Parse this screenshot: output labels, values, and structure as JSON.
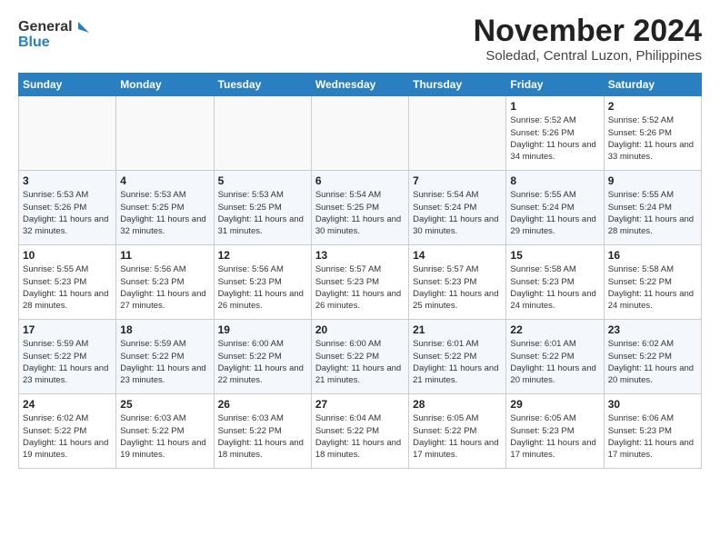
{
  "logo": {
    "text_general": "General",
    "text_blue": "Blue"
  },
  "header": {
    "month": "November 2024",
    "location": "Soledad, Central Luzon, Philippines"
  },
  "weekdays": [
    "Sunday",
    "Monday",
    "Tuesday",
    "Wednesday",
    "Thursday",
    "Friday",
    "Saturday"
  ],
  "weeks": [
    [
      {
        "day": "",
        "info": ""
      },
      {
        "day": "",
        "info": ""
      },
      {
        "day": "",
        "info": ""
      },
      {
        "day": "",
        "info": ""
      },
      {
        "day": "",
        "info": ""
      },
      {
        "day": "1",
        "info": "Sunrise: 5:52 AM\nSunset: 5:26 PM\nDaylight: 11 hours\nand 34 minutes."
      },
      {
        "day": "2",
        "info": "Sunrise: 5:52 AM\nSunset: 5:26 PM\nDaylight: 11 hours\nand 33 minutes."
      }
    ],
    [
      {
        "day": "3",
        "info": "Sunrise: 5:53 AM\nSunset: 5:26 PM\nDaylight: 11 hours\nand 32 minutes."
      },
      {
        "day": "4",
        "info": "Sunrise: 5:53 AM\nSunset: 5:25 PM\nDaylight: 11 hours\nand 32 minutes."
      },
      {
        "day": "5",
        "info": "Sunrise: 5:53 AM\nSunset: 5:25 PM\nDaylight: 11 hours\nand 31 minutes."
      },
      {
        "day": "6",
        "info": "Sunrise: 5:54 AM\nSunset: 5:25 PM\nDaylight: 11 hours\nand 30 minutes."
      },
      {
        "day": "7",
        "info": "Sunrise: 5:54 AM\nSunset: 5:24 PM\nDaylight: 11 hours\nand 30 minutes."
      },
      {
        "day": "8",
        "info": "Sunrise: 5:55 AM\nSunset: 5:24 PM\nDaylight: 11 hours\nand 29 minutes."
      },
      {
        "day": "9",
        "info": "Sunrise: 5:55 AM\nSunset: 5:24 PM\nDaylight: 11 hours\nand 28 minutes."
      }
    ],
    [
      {
        "day": "10",
        "info": "Sunrise: 5:55 AM\nSunset: 5:23 PM\nDaylight: 11 hours\nand 28 minutes."
      },
      {
        "day": "11",
        "info": "Sunrise: 5:56 AM\nSunset: 5:23 PM\nDaylight: 11 hours\nand 27 minutes."
      },
      {
        "day": "12",
        "info": "Sunrise: 5:56 AM\nSunset: 5:23 PM\nDaylight: 11 hours\nand 26 minutes."
      },
      {
        "day": "13",
        "info": "Sunrise: 5:57 AM\nSunset: 5:23 PM\nDaylight: 11 hours\nand 26 minutes."
      },
      {
        "day": "14",
        "info": "Sunrise: 5:57 AM\nSunset: 5:23 PM\nDaylight: 11 hours\nand 25 minutes."
      },
      {
        "day": "15",
        "info": "Sunrise: 5:58 AM\nSunset: 5:23 PM\nDaylight: 11 hours\nand 24 minutes."
      },
      {
        "day": "16",
        "info": "Sunrise: 5:58 AM\nSunset: 5:22 PM\nDaylight: 11 hours\nand 24 minutes."
      }
    ],
    [
      {
        "day": "17",
        "info": "Sunrise: 5:59 AM\nSunset: 5:22 PM\nDaylight: 11 hours\nand 23 minutes."
      },
      {
        "day": "18",
        "info": "Sunrise: 5:59 AM\nSunset: 5:22 PM\nDaylight: 11 hours\nand 23 minutes."
      },
      {
        "day": "19",
        "info": "Sunrise: 6:00 AM\nSunset: 5:22 PM\nDaylight: 11 hours\nand 22 minutes."
      },
      {
        "day": "20",
        "info": "Sunrise: 6:00 AM\nSunset: 5:22 PM\nDaylight: 11 hours\nand 21 minutes."
      },
      {
        "day": "21",
        "info": "Sunrise: 6:01 AM\nSunset: 5:22 PM\nDaylight: 11 hours\nand 21 minutes."
      },
      {
        "day": "22",
        "info": "Sunrise: 6:01 AM\nSunset: 5:22 PM\nDaylight: 11 hours\nand 20 minutes."
      },
      {
        "day": "23",
        "info": "Sunrise: 6:02 AM\nSunset: 5:22 PM\nDaylight: 11 hours\nand 20 minutes."
      }
    ],
    [
      {
        "day": "24",
        "info": "Sunrise: 6:02 AM\nSunset: 5:22 PM\nDaylight: 11 hours\nand 19 minutes."
      },
      {
        "day": "25",
        "info": "Sunrise: 6:03 AM\nSunset: 5:22 PM\nDaylight: 11 hours\nand 19 minutes."
      },
      {
        "day": "26",
        "info": "Sunrise: 6:03 AM\nSunset: 5:22 PM\nDaylight: 11 hours\nand 18 minutes."
      },
      {
        "day": "27",
        "info": "Sunrise: 6:04 AM\nSunset: 5:22 PM\nDaylight: 11 hours\nand 18 minutes."
      },
      {
        "day": "28",
        "info": "Sunrise: 6:05 AM\nSunset: 5:22 PM\nDaylight: 11 hours\nand 17 minutes."
      },
      {
        "day": "29",
        "info": "Sunrise: 6:05 AM\nSunset: 5:23 PM\nDaylight: 11 hours\nand 17 minutes."
      },
      {
        "day": "30",
        "info": "Sunrise: 6:06 AM\nSunset: 5:23 PM\nDaylight: 11 hours\nand 17 minutes."
      }
    ]
  ]
}
